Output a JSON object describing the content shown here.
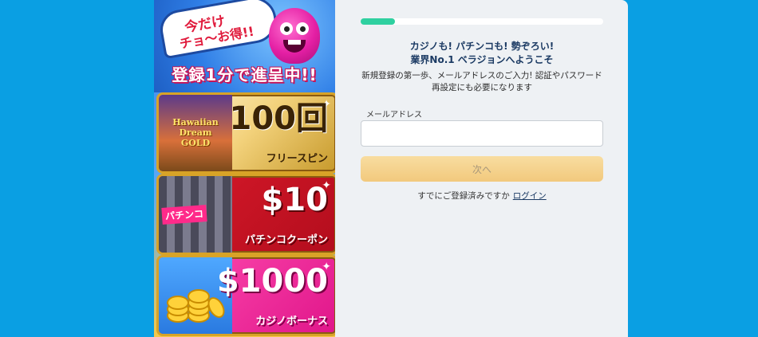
{
  "promo": {
    "bubble_line1": "今だけ",
    "bubble_line2": "チョ〜お得!!",
    "banner": "登録1分で進呈中!!",
    "cards": [
      {
        "badge": "Hawaiian Dream GOLD",
        "big": "100回",
        "small": "フリースピン"
      },
      {
        "badge": "パチンコ",
        "big": "$10",
        "small": "パチンコクーポン"
      },
      {
        "badge": "",
        "big": "$1000",
        "small": "カジノボーナス"
      }
    ]
  },
  "form": {
    "progress": 0.14,
    "headline_line1": "カジノも! パチンコも! 勢ぞろい!",
    "headline_line2": "業界No.1 ベラジョンへようこそ",
    "subtext_line1": "新規登録の第一歩、メールアドレスのご入力! 認証やパスワード",
    "subtext_line2": "再設定にも必要になります",
    "email_label": "メールアドレス",
    "email_value": "",
    "email_placeholder": "",
    "next_label": "次へ",
    "login_prompt": "すでにご登録済みですか",
    "login_link": "ログイン"
  },
  "colors": {
    "background": "#0a9fe3",
    "panel": "#eef1f4",
    "progress": "#2fd0a0",
    "button": "#f2c97d",
    "heading": "#1b3a63"
  },
  "icons": [
    "mascot-icon",
    "coin-icon",
    "sparkle-icon"
  ]
}
